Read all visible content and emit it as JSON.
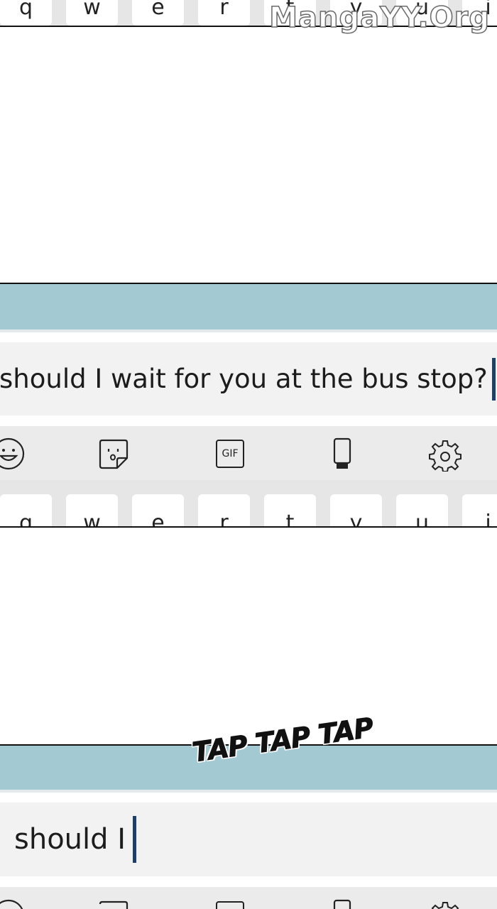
{
  "keyboard_top": {
    "keys": [
      "q",
      "w",
      "e",
      "r",
      "t",
      "y",
      "u",
      "i"
    ]
  },
  "watermark": "MangaYY.Org",
  "panel1": {
    "input_text": "should I wait for you at the bus stop?",
    "toolbar_icons": [
      "emoji-icon",
      "sticker-icon",
      "gif-icon",
      "clipboard-phone-icon",
      "gear-icon"
    ],
    "gif_label": "GIF",
    "keys": [
      "q",
      "w",
      "e",
      "r",
      "t",
      "y",
      "u",
      "i"
    ]
  },
  "sound_effect": "TAP TAP TAP",
  "panel2": {
    "input_text": "should I"
  },
  "colors": {
    "accent_bar": "#a3cad3",
    "cursor": "#1d3f6b",
    "input_bg": "#f2f2f2",
    "toolbar_bg": "#ebebeb"
  }
}
